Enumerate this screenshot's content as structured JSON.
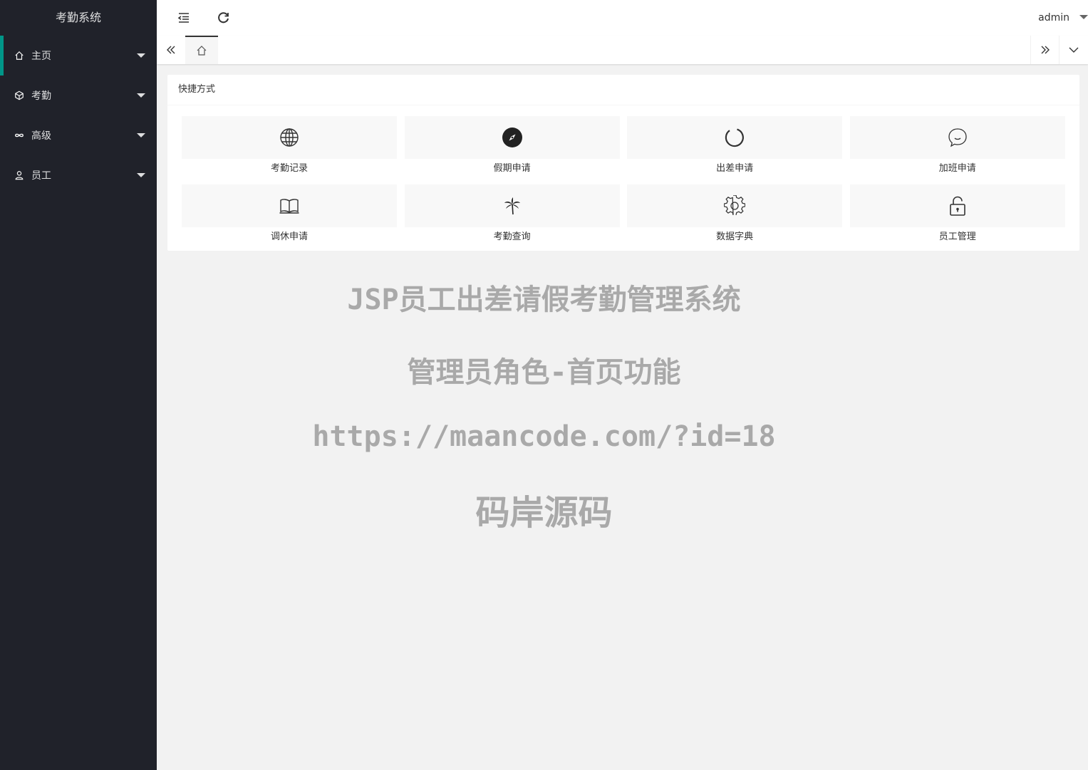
{
  "sidebar": {
    "logo": "考勤系统",
    "items": [
      {
        "label": "主页",
        "icon": "home-icon"
      },
      {
        "label": "考勤",
        "icon": "cube-icon"
      },
      {
        "label": "高级",
        "icon": "infinity-icon"
      },
      {
        "label": "员工",
        "icon": "user-icon"
      }
    ]
  },
  "header": {
    "user": "admin"
  },
  "tabs": {
    "home_icon": "home-icon"
  },
  "shortcuts": {
    "title": "快捷方式",
    "items": [
      {
        "label": "考勤记录",
        "icon": "globe-icon"
      },
      {
        "label": "假期申请",
        "icon": "compass-icon"
      },
      {
        "label": "出差申请",
        "icon": "loading-circle-icon"
      },
      {
        "label": "加班申请",
        "icon": "chat-bubble-icon"
      },
      {
        "label": "调休申请",
        "icon": "book-icon"
      },
      {
        "label": "考勤查询",
        "icon": "palm-tree-icon"
      },
      {
        "label": "数据字典",
        "icon": "gear-icon"
      },
      {
        "label": "员工管理",
        "icon": "unlock-icon"
      }
    ]
  },
  "watermark": {
    "line1": "JSP员工出差请假考勤管理系统",
    "line2": "管理员角色-首页功能",
    "line3": "https://maancode.com/?id=18",
    "line4": "码岸源码"
  },
  "colors": {
    "sidebar_bg": "#20222a",
    "accent": "#009688",
    "content_bg": "#f2f2f2",
    "watermark": "#a9a9a9"
  }
}
